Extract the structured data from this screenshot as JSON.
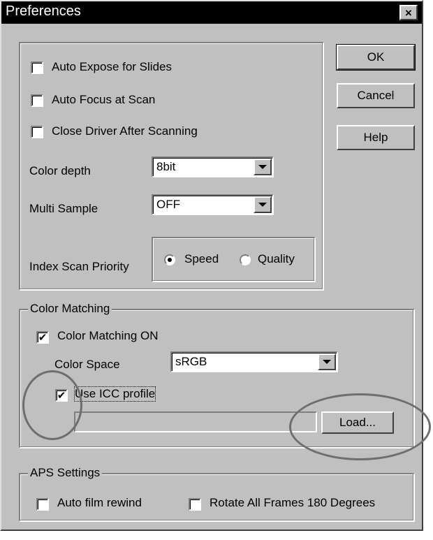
{
  "window": {
    "title": "Preferences",
    "close_glyph": "×"
  },
  "buttons": {
    "ok": "OK",
    "cancel": "Cancel",
    "help": "Help",
    "load": "Load..."
  },
  "options": {
    "auto_expose": {
      "label": "Auto Expose for Slides",
      "checked": false
    },
    "auto_focus": {
      "label": "Auto Focus at Scan",
      "checked": false
    },
    "close_driver": {
      "label": "Close Driver After Scanning",
      "checked": false
    },
    "color_depth": {
      "label": "Color depth",
      "value": "8bit"
    },
    "multi_sample": {
      "label": "Multi Sample",
      "value": "OFF"
    },
    "index_priority": {
      "label": "Index Scan Priority",
      "speed": "Speed",
      "quality": "Quality",
      "selected": "Speed"
    }
  },
  "color_matching": {
    "title": "Color Matching",
    "on_label": "Color Matching ON",
    "on_checked": true,
    "space_label": "Color Space",
    "space_value": "sRGB",
    "icc_label": "Use ICC profile",
    "icc_checked": true,
    "profile_path": ""
  },
  "aps": {
    "title": "APS Settings",
    "rewind_label": "Auto film rewind",
    "rewind_checked": false,
    "rotate_label": "Rotate All Frames 180 Degrees",
    "rotate_checked": false
  },
  "glyphs": {
    "check": "✔"
  },
  "icons": {
    "dropdown": "chevron-down-icon",
    "close": "close-icon"
  },
  "colors": {
    "face": "#c0c0c0",
    "titlebar": "#000000",
    "annotation": "#6e6e6e"
  }
}
